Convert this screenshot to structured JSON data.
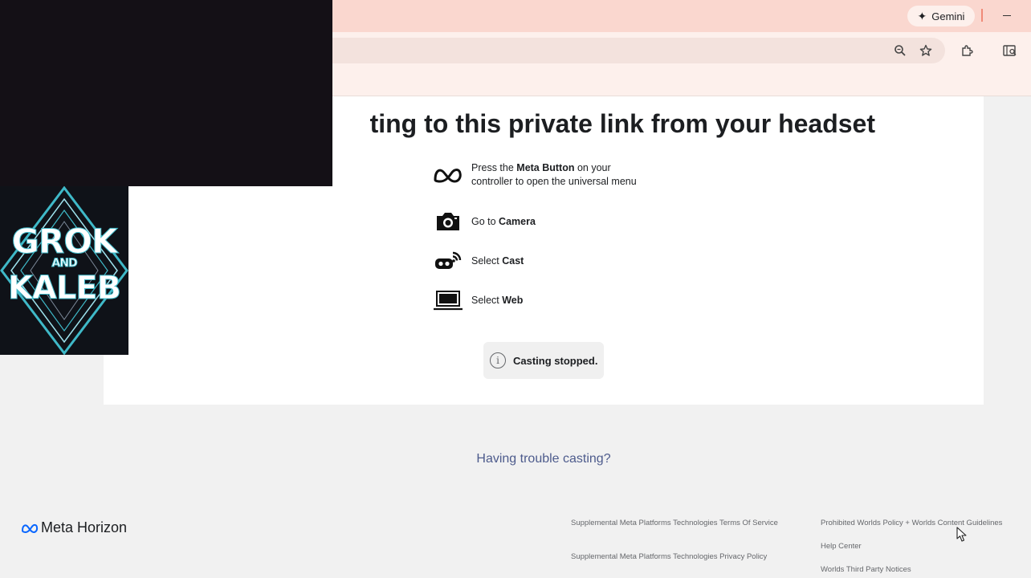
{
  "browser": {
    "gemini_label": "Gemini",
    "icons": [
      "gemini-spark-icon",
      "minimize-icon",
      "zoom-icon",
      "bookmark-star-icon",
      "extensions-icon",
      "sidebar-search-icon"
    ]
  },
  "main": {
    "heading": "ting to this private link from your headset",
    "steps": [
      {
        "icon": "meta-logo-icon",
        "pre": "Press the ",
        "bold": "Meta Button",
        "post": " on your",
        "line2": "controller to open the universal menu"
      },
      {
        "icon": "camera-icon",
        "pre": "Go to ",
        "bold": "Camera"
      },
      {
        "icon": "cast-icon",
        "pre": "Select ",
        "bold": "Cast"
      },
      {
        "icon": "laptop-icon",
        "pre": "Select ",
        "bold": "Web"
      }
    ],
    "toast": "Casting stopped.",
    "trouble_link": "Having trouble casting?"
  },
  "footer": {
    "brand": "Meta Horizon",
    "links": [
      "Supplemental Meta Platforms Technologies Terms Of Service",
      "Supplemental Meta Platforms Technologies Privacy Policy",
      "Prohibited Worlds Policy + Worlds Content Guidelines",
      "Help Center",
      "Worlds Third Party Notices"
    ]
  },
  "overlay": {
    "logo_lines": [
      "GROK",
      "AND",
      "KALEB"
    ]
  },
  "colors": {
    "titlebar": "#fad7cf",
    "toolbar": "#fdf0ec",
    "link": "#4d5b8c",
    "logo_accent": "#3fb9c8"
  }
}
